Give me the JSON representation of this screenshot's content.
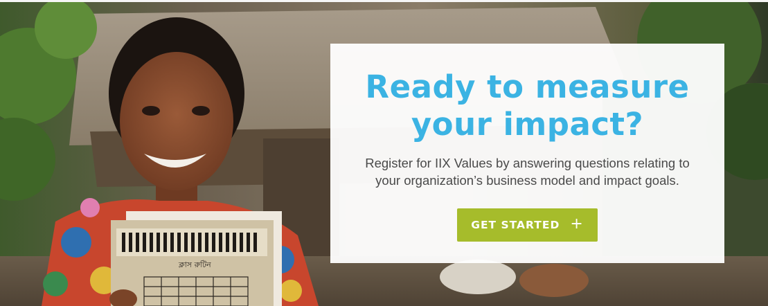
{
  "colors": {
    "title": "#3bb3e3",
    "button_bg": "#a6bc2b",
    "button_text": "#ffffff",
    "body_text": "#4a4a4a"
  },
  "hero": {
    "photo": "girl-holding-workbooks-in-village"
  },
  "cta": {
    "title_line1": "Ready to measure",
    "title_line2": "your impact?",
    "desc_line1": "Register for IIX Values by answering questions relating to",
    "desc_line2": "your organization’s business model and impact goals.",
    "button_label": "GET STARTED",
    "button_icon": "plus-icon",
    "button_icon_glyph": "+"
  },
  "book": {
    "cover_text": "ক্লাস রুটিন"
  }
}
